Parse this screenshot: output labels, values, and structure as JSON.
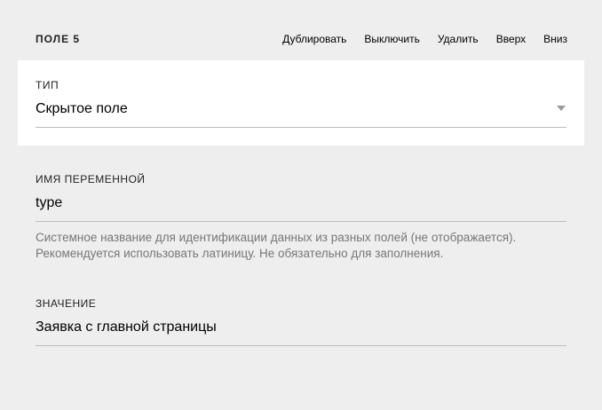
{
  "header": {
    "title": "ПОЛЕ 5",
    "actions": {
      "duplicate": "Дублировать",
      "disable": "Выключить",
      "delete": "Удалить",
      "up": "Вверх",
      "down": "Вниз"
    }
  },
  "type_field": {
    "label": "ТИП",
    "value": "Скрытое поле",
    "icon": "chevron-down-icon"
  },
  "variable_field": {
    "label": "ИМЯ ПЕРЕМЕННОЙ",
    "value": "type",
    "hint_line1": "Системное название для идентификации данных из разных полей (не отображается).",
    "hint_line2": "Рекомендуется использовать латиницу. Не обязательно для заполнения."
  },
  "value_field": {
    "label": "ЗНАЧЕНИЕ",
    "value": "Заявка с главной страницы"
  },
  "colors": {
    "background": "#eeeeee",
    "panel": "#ffffff",
    "underline": "#bdbdbd",
    "hint_text": "#777777",
    "arrow": "#999999"
  }
}
